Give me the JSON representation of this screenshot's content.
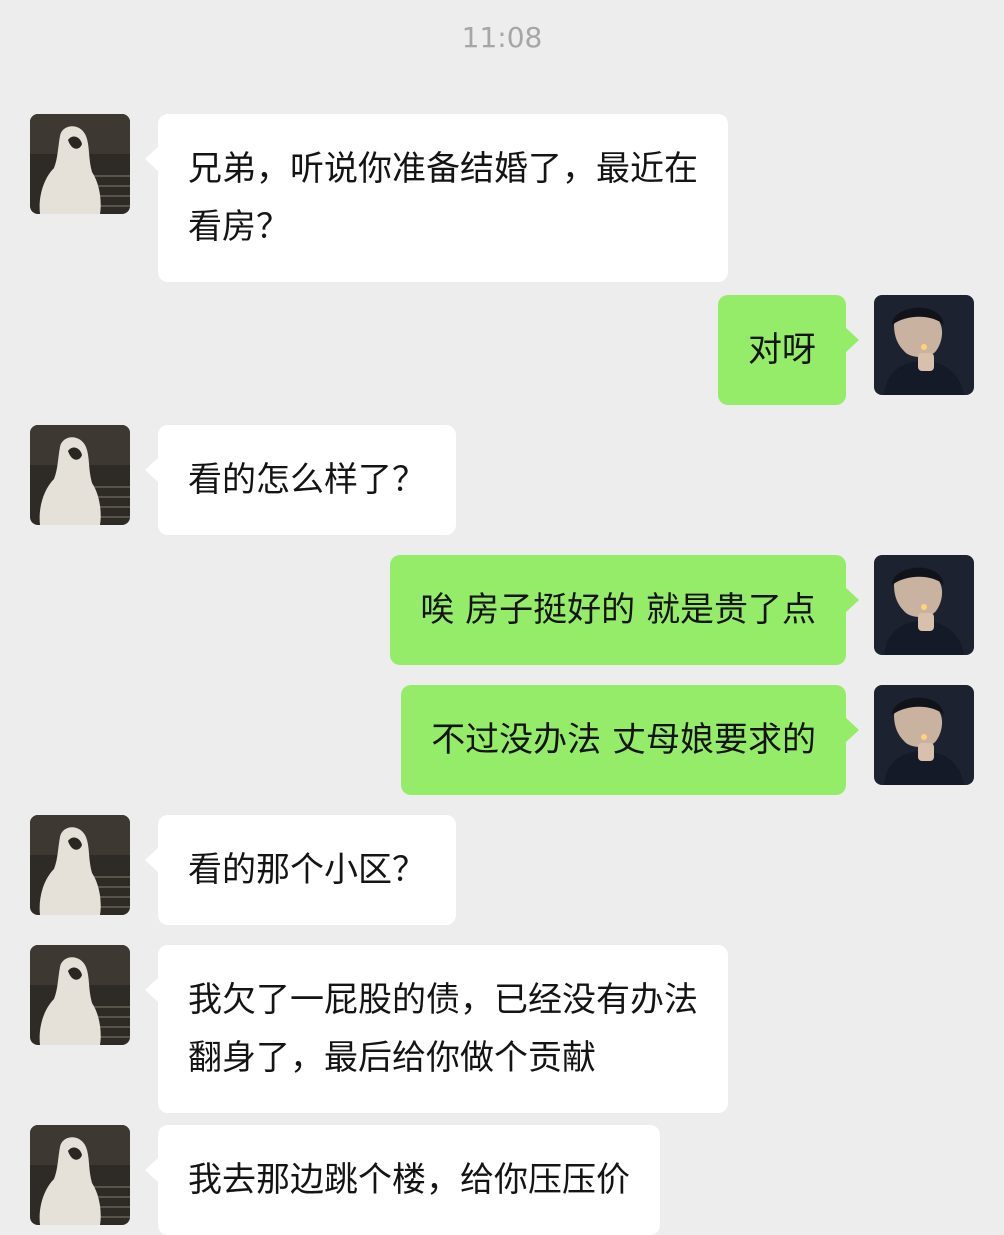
{
  "chat": {
    "timestamp": "11:08",
    "messages": [
      {
        "side": "in",
        "lines": [
          "兄弟，听说你准备结婚了，最近在",
          "看房？"
        ]
      },
      {
        "side": "out",
        "lines": [
          "对呀"
        ]
      },
      {
        "side": "in",
        "lines": [
          "看的怎么样了？"
        ]
      },
      {
        "side": "out",
        "lines": [
          "唉 房子挺好的 就是贵了点"
        ]
      },
      {
        "side": "out",
        "lines": [
          "不过没办法 丈母娘要求的"
        ]
      },
      {
        "side": "in",
        "lines": [
          "看的那个小区？"
        ]
      },
      {
        "side": "in",
        "lines": [
          "我欠了一屁股的债，已经没有办法",
          "翻身了，最后给你做个贡献"
        ]
      },
      {
        "side": "in",
        "lines": [
          "我去那边跳个楼，给你压压价"
        ]
      }
    ]
  },
  "colors": {
    "background": "#ededed",
    "incoming_bubble": "#ffffff",
    "outgoing_bubble": "#95ec69",
    "timestamp_text": "#a6a6a6"
  },
  "icons": {
    "incoming_avatar": "hooded-figure-avatar-icon",
    "outgoing_avatar": "man-lighting-cigarette-avatar-icon"
  }
}
